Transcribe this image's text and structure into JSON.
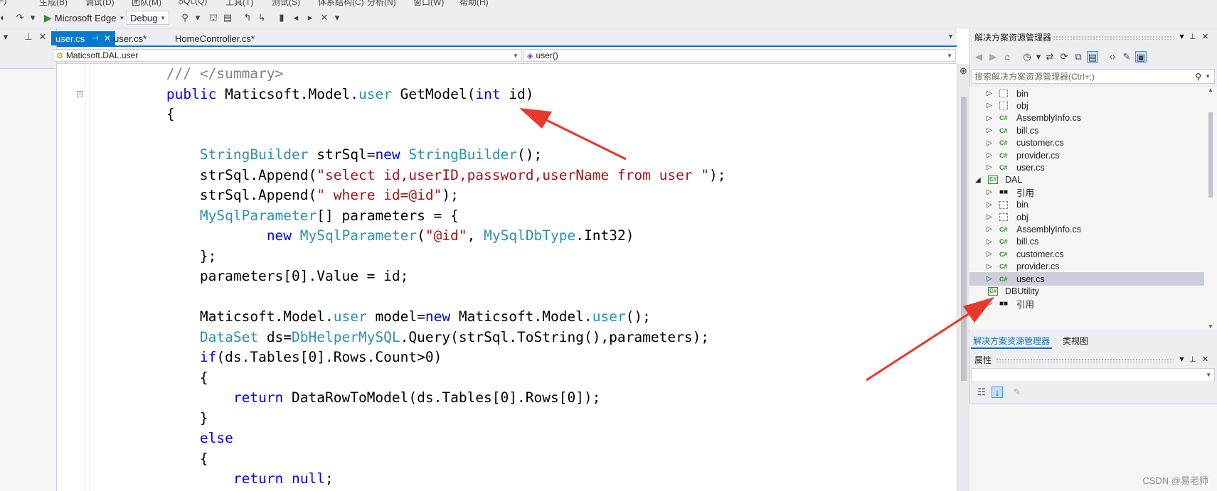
{
  "menu": {
    "items": [
      "(F)",
      "生成(B)",
      "调试(D)",
      "团队(M)",
      "SQL(Q)",
      "工具(T)",
      "测试(S)",
      "体系结构(C)",
      "分析(N)",
      "窗口(W)",
      "帮助(H)"
    ]
  },
  "toolbar": {
    "run_target": "Microsoft Edge",
    "configuration": "Debug"
  },
  "tabs": [
    {
      "label": "user.cs",
      "active": true
    },
    {
      "label": "user.cs*",
      "active": false
    },
    {
      "label": "HomeController.cs*",
      "active": false
    }
  ],
  "nav": {
    "type_combo": "Maticsoft.DAL.user",
    "member_combo": "user()"
  },
  "code": {
    "lines": [
      [
        {
          "t": "        /// </summary>",
          "c": "cm"
        }
      ],
      [
        {
          "t": "        ",
          "c": "pl"
        },
        {
          "t": "public",
          "c": "kw"
        },
        {
          "t": " Maticsoft.Model.",
          "c": "pl"
        },
        {
          "t": "user",
          "c": "tp"
        },
        {
          "t": " GetModel(",
          "c": "pl"
        },
        {
          "t": "int",
          "c": "kw"
        },
        {
          "t": " id)",
          "c": "pl"
        }
      ],
      [
        {
          "t": "        {",
          "c": "pl"
        }
      ],
      [
        {
          "t": "",
          "c": "pl"
        }
      ],
      [
        {
          "t": "            ",
          "c": "pl"
        },
        {
          "t": "StringBuilder",
          "c": "tp"
        },
        {
          "t": " strSql=",
          "c": "pl"
        },
        {
          "t": "new",
          "c": "kw"
        },
        {
          "t": " ",
          "c": "pl"
        },
        {
          "t": "StringBuilder",
          "c": "tp"
        },
        {
          "t": "();",
          "c": "pl"
        }
      ],
      [
        {
          "t": "            strSql.Append(",
          "c": "pl"
        },
        {
          "t": "\"select id,userID,password,userName from user \"",
          "c": "str"
        },
        {
          "t": ");",
          "c": "pl"
        }
      ],
      [
        {
          "t": "            strSql.Append(",
          "c": "pl"
        },
        {
          "t": "\" where id=@id\"",
          "c": "str"
        },
        {
          "t": ");",
          "c": "pl"
        }
      ],
      [
        {
          "t": "            ",
          "c": "pl"
        },
        {
          "t": "MySqlParameter",
          "c": "tp"
        },
        {
          "t": "[] parameters = {",
          "c": "pl"
        }
      ],
      [
        {
          "t": "                    ",
          "c": "pl"
        },
        {
          "t": "new",
          "c": "kw"
        },
        {
          "t": " ",
          "c": "pl"
        },
        {
          "t": "MySqlParameter",
          "c": "tp"
        },
        {
          "t": "(",
          "c": "pl"
        },
        {
          "t": "\"@id\"",
          "c": "str"
        },
        {
          "t": ", ",
          "c": "pl"
        },
        {
          "t": "MySqlDbType",
          "c": "tp"
        },
        {
          "t": ".Int32)",
          "c": "pl"
        }
      ],
      [
        {
          "t": "            };",
          "c": "pl"
        }
      ],
      [
        {
          "t": "            parameters[0].Value = id;",
          "c": "pl"
        }
      ],
      [
        {
          "t": "",
          "c": "pl"
        }
      ],
      [
        {
          "t": "            Maticsoft.Model.",
          "c": "pl"
        },
        {
          "t": "user",
          "c": "tp"
        },
        {
          "t": " model=",
          "c": "pl"
        },
        {
          "t": "new",
          "c": "kw"
        },
        {
          "t": " Maticsoft.Model.",
          "c": "pl"
        },
        {
          "t": "user",
          "c": "tp"
        },
        {
          "t": "();",
          "c": "pl"
        }
      ],
      [
        {
          "t": "            ",
          "c": "pl"
        },
        {
          "t": "DataSet",
          "c": "tp"
        },
        {
          "t": " ds=",
          "c": "pl"
        },
        {
          "t": "DbHelperMySQL",
          "c": "tp"
        },
        {
          "t": ".Query(strSql.ToString(),parameters);",
          "c": "pl"
        }
      ],
      [
        {
          "t": "            ",
          "c": "pl"
        },
        {
          "t": "if",
          "c": "kw"
        },
        {
          "t": "(ds.Tables[0].Rows.Count>0)",
          "c": "pl"
        }
      ],
      [
        {
          "t": "            {",
          "c": "pl"
        }
      ],
      [
        {
          "t": "                ",
          "c": "pl"
        },
        {
          "t": "return",
          "c": "kw"
        },
        {
          "t": " DataRowToModel(ds.Tables[0].Rows[0]);",
          "c": "pl"
        }
      ],
      [
        {
          "t": "            }",
          "c": "pl"
        }
      ],
      [
        {
          "t": "            ",
          "c": "pl"
        },
        {
          "t": "else",
          "c": "kw"
        }
      ],
      [
        {
          "t": "            {",
          "c": "pl"
        }
      ],
      [
        {
          "t": "                ",
          "c": "pl"
        },
        {
          "t": "return",
          "c": "kw"
        },
        {
          "t": " ",
          "c": "pl"
        },
        {
          "t": "null",
          "c": "kw"
        },
        {
          "t": ";",
          "c": "pl"
        }
      ],
      [
        {
          "t": "            }",
          "c": "pl"
        }
      ]
    ]
  },
  "solution_explorer": {
    "title": "解决方案资源管理器",
    "search_placeholder": "搜索解决方案资源管理器(Ctrl+;)",
    "tree": [
      {
        "label": "bin",
        "icon": "folder",
        "level": 2,
        "expander": "▷"
      },
      {
        "label": "obj",
        "icon": "folder",
        "level": 2,
        "expander": "▷"
      },
      {
        "label": "AssemblyInfo.cs",
        "icon": "cs",
        "level": 2,
        "expander": "▷"
      },
      {
        "label": "bill.cs",
        "icon": "cs",
        "level": 2,
        "expander": "▷"
      },
      {
        "label": "customer.cs",
        "icon": "cs",
        "level": 2,
        "expander": "▷"
      },
      {
        "label": "provider.cs",
        "icon": "cs",
        "level": 2,
        "expander": "▷"
      },
      {
        "label": "user.cs",
        "icon": "cs",
        "level": 2,
        "expander": "▷"
      },
      {
        "label": "DAL",
        "icon": "proj",
        "level": 1,
        "expander": "◢"
      },
      {
        "label": "引用",
        "icon": "ref",
        "level": 2,
        "expander": "▷"
      },
      {
        "label": "bin",
        "icon": "folder",
        "level": 2,
        "expander": "▷"
      },
      {
        "label": "obj",
        "icon": "folder",
        "level": 2,
        "expander": "▷"
      },
      {
        "label": "AssemblyInfo.cs",
        "icon": "cs",
        "level": 2,
        "expander": "▷"
      },
      {
        "label": "bill.cs",
        "icon": "cs",
        "level": 2,
        "expander": "▷"
      },
      {
        "label": "customer.cs",
        "icon": "cs",
        "level": 2,
        "expander": "▷"
      },
      {
        "label": "provider.cs",
        "icon": "cs",
        "level": 2,
        "expander": "▷"
      },
      {
        "label": "user.cs",
        "icon": "cs",
        "level": 2,
        "expander": "▷",
        "selected": true
      },
      {
        "label": "DBUtility",
        "icon": "proj",
        "level": 1,
        "expander": ""
      },
      {
        "label": "引用",
        "icon": "ref",
        "level": 2,
        "expander": "▷"
      }
    ],
    "bottom_tabs": [
      "解决方案资源管理器",
      "类视图"
    ]
  },
  "properties": {
    "title": "属性"
  },
  "icons": {
    "cs": "C#",
    "proj": "C#",
    "ref": "■■"
  },
  "watermark": "CSDN @易老师",
  "colors": {
    "accent": "#007acc",
    "keyword": "#0000ff",
    "type": "#2b91af",
    "string": "#a31515",
    "comment": "#808080",
    "arrow": "#e8372c"
  }
}
